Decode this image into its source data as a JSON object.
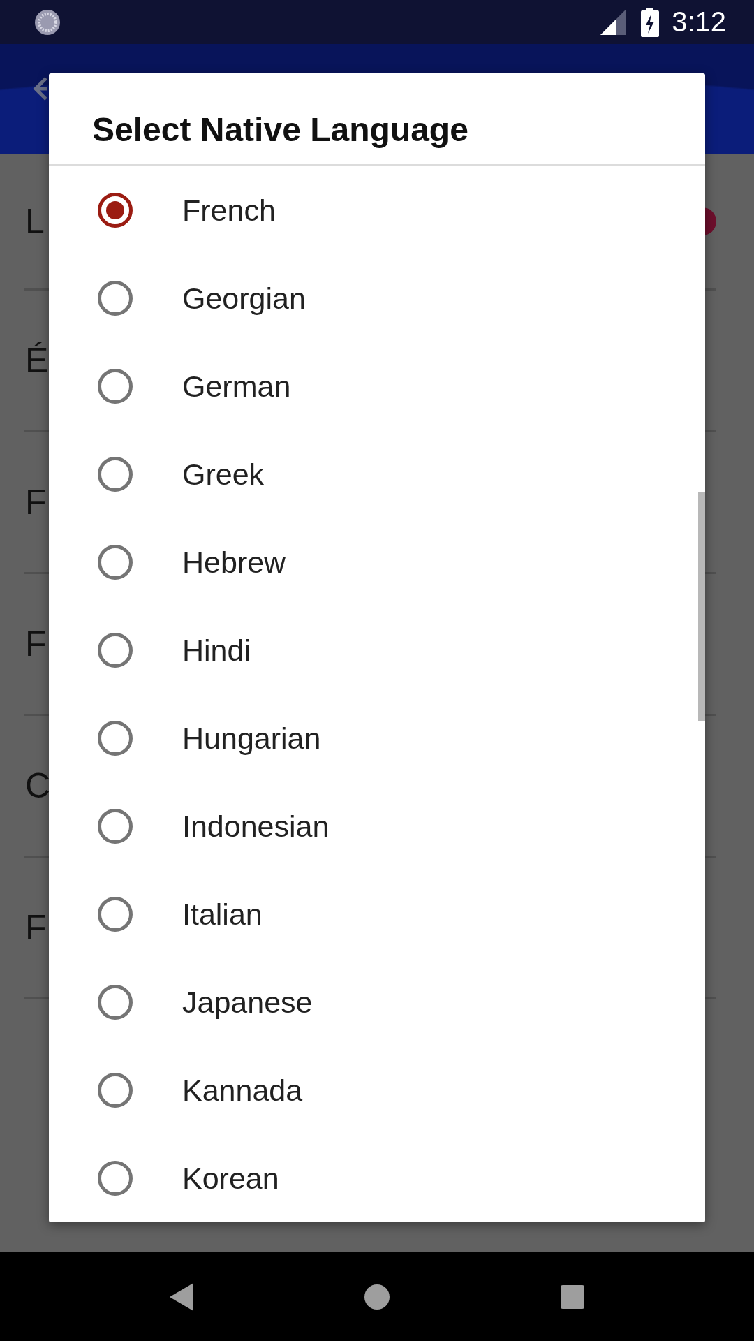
{
  "status_bar": {
    "time": "3:12"
  },
  "background_rows": [
    {
      "label": "L",
      "badge": true
    },
    {
      "label": "É",
      "badge": false
    },
    {
      "label": "F",
      "badge": false
    },
    {
      "label": "F",
      "badge": false
    },
    {
      "label": "C",
      "badge": false
    },
    {
      "label": "F",
      "badge": false
    }
  ],
  "dialog": {
    "title": "Select Native Language",
    "options": [
      {
        "label": "French",
        "selected": true
      },
      {
        "label": "Georgian",
        "selected": false
      },
      {
        "label": "German",
        "selected": false
      },
      {
        "label": "Greek",
        "selected": false
      },
      {
        "label": "Hebrew",
        "selected": false
      },
      {
        "label": "Hindi",
        "selected": false
      },
      {
        "label": "Hungarian",
        "selected": false
      },
      {
        "label": "Indonesian",
        "selected": false
      },
      {
        "label": "Italian",
        "selected": false
      },
      {
        "label": "Japanese",
        "selected": false
      },
      {
        "label": "Kannada",
        "selected": false
      },
      {
        "label": "Korean",
        "selected": false
      }
    ]
  }
}
